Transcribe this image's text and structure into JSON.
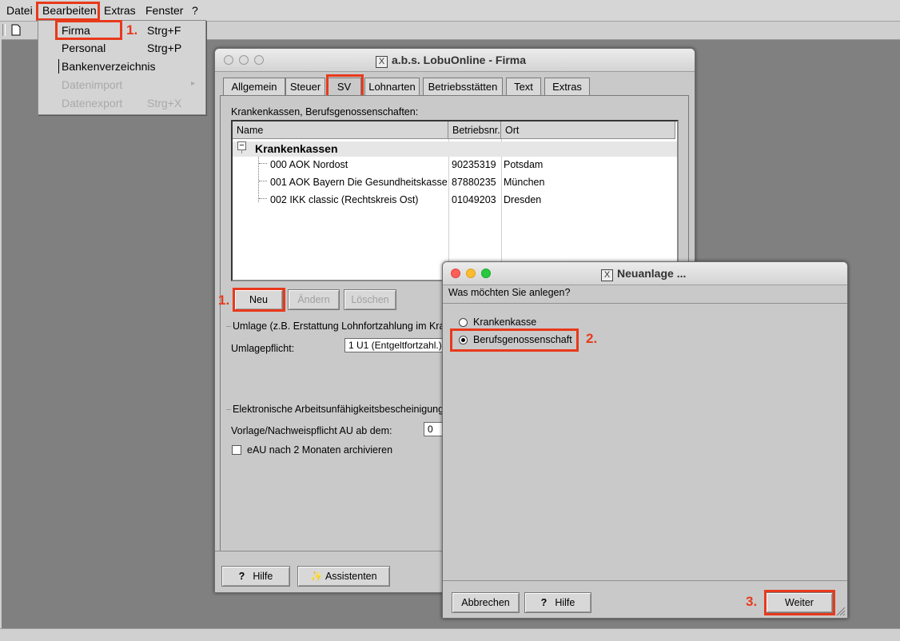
{
  "menubar": {
    "items": [
      {
        "label": "Datei"
      },
      {
        "label": "Bearbeiten"
      },
      {
        "label": "Extras"
      },
      {
        "label": "Fenster"
      },
      {
        "label": "?"
      }
    ]
  },
  "dropdown": {
    "items": [
      {
        "label": "Firma",
        "shortcut": "Strg+F",
        "enabled": true
      },
      {
        "label": "Personal",
        "shortcut": "Strg+P",
        "enabled": true
      },
      {
        "label": "Bankenverzeichnis",
        "shortcut": "",
        "enabled": true
      },
      {
        "label": "Datenimport",
        "shortcut": "",
        "enabled": false
      },
      {
        "label": "Datenexport",
        "shortcut": "Strg+X",
        "enabled": false
      }
    ]
  },
  "annotations": {
    "step1": "1.",
    "step2": "2.",
    "step3": "3.",
    "color": "#e8391b"
  },
  "firma_window": {
    "title": "a.b.s. LobuOnline - Firma",
    "tabs": [
      "Allgemein",
      "Steuer",
      "SV",
      "Lohnarten",
      "Betriebsstätten",
      "Text",
      "Extras"
    ],
    "active_tab": "SV",
    "section_label": "Krankenkassen, Berufsgenossenschaften:",
    "grid": {
      "columns": [
        "Name",
        "Betriebsnr.",
        "Ort"
      ],
      "group": "Krankenkassen",
      "rows": [
        {
          "name": "000 AOK Nordost",
          "nr": "90235319",
          "ort": "Potsdam"
        },
        {
          "name": "001 AOK Bayern Die Gesundheitskasse",
          "nr": "87880235",
          "ort": "München"
        },
        {
          "name": "002 IKK classic (Rechtskreis Ost)",
          "nr": "01049203",
          "ort": "Dresden"
        }
      ]
    },
    "buttons": {
      "neu": "Neu",
      "aendern": "Ändern",
      "loeschen": "Löschen"
    },
    "umlage_title": "Umlage (z.B. Erstattung Lohnfortzahlung im Kran",
    "umlagepflicht_label": "Umlagepflicht:",
    "umlagepflicht_value": "1 U1 (Entgeltfortzahl.)",
    "eau_title": "Elektronische Arbeitsunfähigkeitsbescheinigung",
    "vorlage_label": "Vorlage/Nachweispflicht AU ab dem:",
    "vorlage_value": "0",
    "archiv_label": "eAU nach 2 Monaten archivieren",
    "hilfe": "Hilfe",
    "assistenten": "Assistenten"
  },
  "neu_dialog": {
    "title": "Neuanlage ...",
    "question": "Was möchten Sie anlegen?",
    "options": [
      "Krankenkasse",
      "Berufsgenossenschaft"
    ],
    "selected": "Berufsgenossenschaft",
    "abbrechen": "Abbrechen",
    "hilfe": "Hilfe",
    "weiter": "Weiter"
  }
}
